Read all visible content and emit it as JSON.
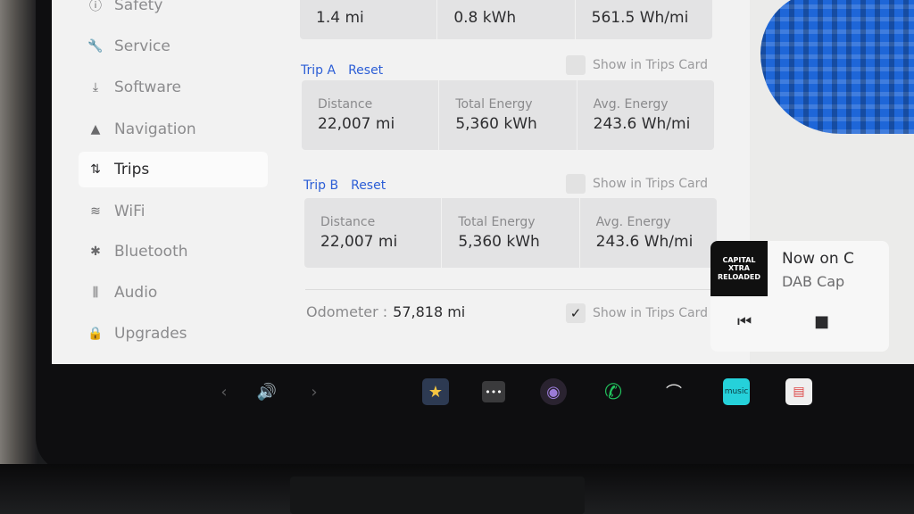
{
  "sidebar": {
    "items": [
      {
        "label": "Safety",
        "icon": "info-circle-icon",
        "glyph": "ⓘ"
      },
      {
        "label": "Service",
        "icon": "wrench-icon",
        "glyph": "🔧"
      },
      {
        "label": "Software",
        "icon": "download-icon",
        "glyph": "⤓"
      },
      {
        "label": "Navigation",
        "icon": "navigation-arrow-icon",
        "glyph": "▲"
      },
      {
        "label": "Trips",
        "icon": "trips-icon",
        "glyph": "⇅"
      },
      {
        "label": "WiFi",
        "icon": "wifi-icon",
        "glyph": "≋"
      },
      {
        "label": "Bluetooth",
        "icon": "bluetooth-icon",
        "glyph": "✱"
      },
      {
        "label": "Audio",
        "icon": "equalizer-icon",
        "glyph": "⫼"
      },
      {
        "label": "Upgrades",
        "icon": "lock-icon",
        "glyph": "🔒"
      }
    ],
    "active": "Trips"
  },
  "top_card": {
    "distance": "1.4 mi",
    "energy": "0.8 kWh",
    "avg": "561.5 Wh/mi"
  },
  "trip_a": {
    "title": "Trip A",
    "reset": "Reset",
    "show_label": "Show in Trips Card",
    "show_checked": false,
    "distance_label": "Distance",
    "distance": "22,007 mi",
    "energy_label": "Total Energy",
    "energy": "5,360 kWh",
    "avg_label": "Avg. Energy",
    "avg": "243.6 Wh/mi"
  },
  "trip_b": {
    "title": "Trip B",
    "reset": "Reset",
    "show_label": "Show in Trips Card",
    "show_checked": false,
    "distance_label": "Distance",
    "distance": "22,007 mi",
    "energy_label": "Total Energy",
    "energy": "5,360 kWh",
    "avg_label": "Avg. Energy",
    "avg": "243.6 Wh/mi"
  },
  "odometer": {
    "label": "Odometer :",
    "value": "57,818 mi",
    "show_label": "Show in Trips Card",
    "show_checked": true,
    "check_glyph": "✓"
  },
  "media": {
    "art_text": "CAPITAL XTRA RELOADED",
    "title": "Now on C",
    "subtitle": "DAB Cap",
    "prev_glyph": "⏮",
    "stop_glyph": "■"
  },
  "dock": [
    {
      "name": "left-chevron-icon",
      "glyph": "‹"
    },
    {
      "name": "volume-icon",
      "glyph": "🔊"
    },
    {
      "name": "right-chevron-icon",
      "glyph": "›"
    },
    {
      "name": "toybox-icon",
      "glyph": "★"
    },
    {
      "name": "more-apps-icon",
      "glyph": "•••"
    },
    {
      "name": "camera-icon",
      "glyph": "◉"
    },
    {
      "name": "phone-icon",
      "glyph": "✆"
    },
    {
      "name": "wiper-icon",
      "glyph": "⌒"
    },
    {
      "name": "amazon-music-icon",
      "glyph": "music"
    },
    {
      "name": "calendar-icon",
      "glyph": "▤"
    }
  ],
  "colors": {
    "accent": "#2c5ed6",
    "phone": "#22c55e",
    "music": "#25d1da",
    "car": "#1e66d8"
  }
}
